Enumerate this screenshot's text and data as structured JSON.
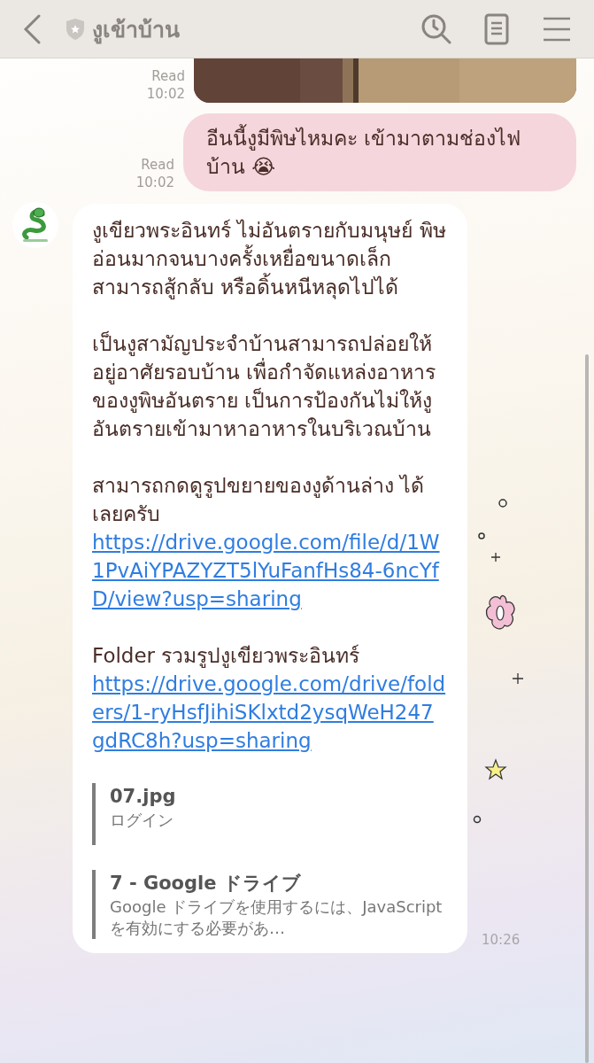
{
  "header": {
    "title": "งูเข้าบ้าน"
  },
  "messages": [
    {
      "read": "Read",
      "time": "10:02"
    },
    {
      "kind": "outgoing",
      "read": "Read",
      "time": "10:02",
      "text": "อีนนี้งูมีพิษไหมคะ เข้ามาตามช่องไฟบ้าน 😭"
    },
    {
      "kind": "incoming",
      "time": "10:26",
      "blocks": [
        {
          "parts": [
            {
              "kind": "text",
              "text": "งูเขียวพระอินทร์ ไม่อันตรายกับมนุษย์ พิษอ่อนมากจนบางครั้งเหยื่อขนาดเล็กสามารถสู้กลับ หรือดิ้นหนีหลุดไปได้"
            }
          ]
        },
        {
          "parts": [
            {
              "kind": "text",
              "text": "เป็นงูสามัญประจำบ้านสามารถปล่อยให้อยู่อาศัยรอบบ้าน เพื่อกำจัดแหล่งอาหารของงูพิษอันตราย เป็นการป้องกันไม่ให้งูอันตรายเข้ามาหาอาหารในบริเวณบ้าน"
            }
          ]
        },
        {
          "parts": [
            {
              "kind": "text",
              "text": "สามารถกดดูรูปขยายของงูด้านล่าง ได้เลยครับ"
            },
            {
              "kind": "link",
              "text": "https://drive.google.com/file/d/1W1PvAiYPAZYZT5lYuFanfHs84-6ncYfD/view?usp=sharing"
            }
          ]
        },
        {
          "parts": [
            {
              "kind": "text",
              "text": "Folder รวมรูปงูเขียวพระอินทร์"
            },
            {
              "kind": "link",
              "text": "https://drive.google.com/drive/folders/1-ryHsfJihiSKlxtd2ysqWeH247gdRC8h?usp=sharing"
            }
          ]
        }
      ],
      "previews": [
        {
          "title": "07.jpg",
          "description": "ログイン"
        },
        {
          "title": "7 - Google ドライブ",
          "description": "Google ドライブを使用するには、JavaScript を有効にする必要があ…"
        }
      ]
    }
  ]
}
